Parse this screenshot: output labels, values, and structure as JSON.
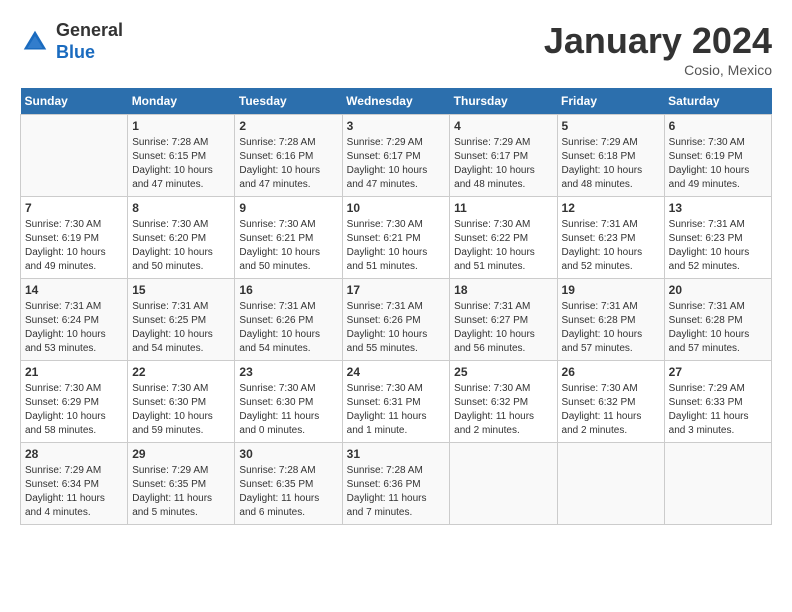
{
  "header": {
    "logo_general": "General",
    "logo_blue": "Blue",
    "month_title": "January 2024",
    "location": "Cosio, Mexico"
  },
  "days_of_week": [
    "Sunday",
    "Monday",
    "Tuesday",
    "Wednesday",
    "Thursday",
    "Friday",
    "Saturday"
  ],
  "weeks": [
    [
      {
        "day": "",
        "info": ""
      },
      {
        "day": "1",
        "info": "Sunrise: 7:28 AM\nSunset: 6:15 PM\nDaylight: 10 hours\nand 47 minutes."
      },
      {
        "day": "2",
        "info": "Sunrise: 7:28 AM\nSunset: 6:16 PM\nDaylight: 10 hours\nand 47 minutes."
      },
      {
        "day": "3",
        "info": "Sunrise: 7:29 AM\nSunset: 6:17 PM\nDaylight: 10 hours\nand 47 minutes."
      },
      {
        "day": "4",
        "info": "Sunrise: 7:29 AM\nSunset: 6:17 PM\nDaylight: 10 hours\nand 48 minutes."
      },
      {
        "day": "5",
        "info": "Sunrise: 7:29 AM\nSunset: 6:18 PM\nDaylight: 10 hours\nand 48 minutes."
      },
      {
        "day": "6",
        "info": "Sunrise: 7:30 AM\nSunset: 6:19 PM\nDaylight: 10 hours\nand 49 minutes."
      }
    ],
    [
      {
        "day": "7",
        "info": "Sunrise: 7:30 AM\nSunset: 6:19 PM\nDaylight: 10 hours\nand 49 minutes."
      },
      {
        "day": "8",
        "info": "Sunrise: 7:30 AM\nSunset: 6:20 PM\nDaylight: 10 hours\nand 50 minutes."
      },
      {
        "day": "9",
        "info": "Sunrise: 7:30 AM\nSunset: 6:21 PM\nDaylight: 10 hours\nand 50 minutes."
      },
      {
        "day": "10",
        "info": "Sunrise: 7:30 AM\nSunset: 6:21 PM\nDaylight: 10 hours\nand 51 minutes."
      },
      {
        "day": "11",
        "info": "Sunrise: 7:30 AM\nSunset: 6:22 PM\nDaylight: 10 hours\nand 51 minutes."
      },
      {
        "day": "12",
        "info": "Sunrise: 7:31 AM\nSunset: 6:23 PM\nDaylight: 10 hours\nand 52 minutes."
      },
      {
        "day": "13",
        "info": "Sunrise: 7:31 AM\nSunset: 6:23 PM\nDaylight: 10 hours\nand 52 minutes."
      }
    ],
    [
      {
        "day": "14",
        "info": "Sunrise: 7:31 AM\nSunset: 6:24 PM\nDaylight: 10 hours\nand 53 minutes."
      },
      {
        "day": "15",
        "info": "Sunrise: 7:31 AM\nSunset: 6:25 PM\nDaylight: 10 hours\nand 54 minutes."
      },
      {
        "day": "16",
        "info": "Sunrise: 7:31 AM\nSunset: 6:26 PM\nDaylight: 10 hours\nand 54 minutes."
      },
      {
        "day": "17",
        "info": "Sunrise: 7:31 AM\nSunset: 6:26 PM\nDaylight: 10 hours\nand 55 minutes."
      },
      {
        "day": "18",
        "info": "Sunrise: 7:31 AM\nSunset: 6:27 PM\nDaylight: 10 hours\nand 56 minutes."
      },
      {
        "day": "19",
        "info": "Sunrise: 7:31 AM\nSunset: 6:28 PM\nDaylight: 10 hours\nand 57 minutes."
      },
      {
        "day": "20",
        "info": "Sunrise: 7:31 AM\nSunset: 6:28 PM\nDaylight: 10 hours\nand 57 minutes."
      }
    ],
    [
      {
        "day": "21",
        "info": "Sunrise: 7:30 AM\nSunset: 6:29 PM\nDaylight: 10 hours\nand 58 minutes."
      },
      {
        "day": "22",
        "info": "Sunrise: 7:30 AM\nSunset: 6:30 PM\nDaylight: 10 hours\nand 59 minutes."
      },
      {
        "day": "23",
        "info": "Sunrise: 7:30 AM\nSunset: 6:30 PM\nDaylight: 11 hours\nand 0 minutes."
      },
      {
        "day": "24",
        "info": "Sunrise: 7:30 AM\nSunset: 6:31 PM\nDaylight: 11 hours\nand 1 minute."
      },
      {
        "day": "25",
        "info": "Sunrise: 7:30 AM\nSunset: 6:32 PM\nDaylight: 11 hours\nand 2 minutes."
      },
      {
        "day": "26",
        "info": "Sunrise: 7:30 AM\nSunset: 6:32 PM\nDaylight: 11 hours\nand 2 minutes."
      },
      {
        "day": "27",
        "info": "Sunrise: 7:29 AM\nSunset: 6:33 PM\nDaylight: 11 hours\nand 3 minutes."
      }
    ],
    [
      {
        "day": "28",
        "info": "Sunrise: 7:29 AM\nSunset: 6:34 PM\nDaylight: 11 hours\nand 4 minutes."
      },
      {
        "day": "29",
        "info": "Sunrise: 7:29 AM\nSunset: 6:35 PM\nDaylight: 11 hours\nand 5 minutes."
      },
      {
        "day": "30",
        "info": "Sunrise: 7:28 AM\nSunset: 6:35 PM\nDaylight: 11 hours\nand 6 minutes."
      },
      {
        "day": "31",
        "info": "Sunrise: 7:28 AM\nSunset: 6:36 PM\nDaylight: 11 hours\nand 7 minutes."
      },
      {
        "day": "",
        "info": ""
      },
      {
        "day": "",
        "info": ""
      },
      {
        "day": "",
        "info": ""
      }
    ]
  ]
}
